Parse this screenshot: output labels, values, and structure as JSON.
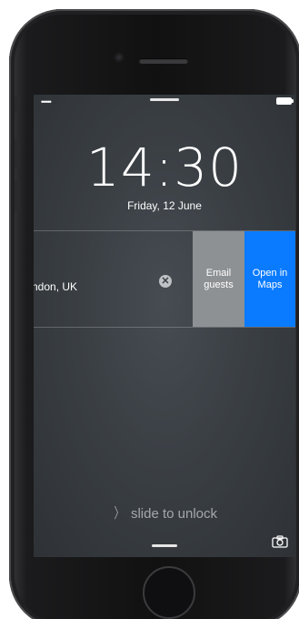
{
  "status_bar": {
    "signal": "•••••"
  },
  "lock_screen": {
    "time": "14:30",
    "date": "Friday, 12 June"
  },
  "notification": {
    "text": "ndon, UK",
    "clear_symbol": "✕",
    "actions": [
      {
        "label": "Email guests",
        "color": "#8e9194"
      },
      {
        "label": "Open in Maps",
        "color": "#0a7bff"
      }
    ]
  },
  "unlock": {
    "chevron": "〉",
    "label": "slide to unlock"
  },
  "icons": {
    "camera": "camera-icon",
    "battery": "battery-icon",
    "clear": "close-icon"
  }
}
